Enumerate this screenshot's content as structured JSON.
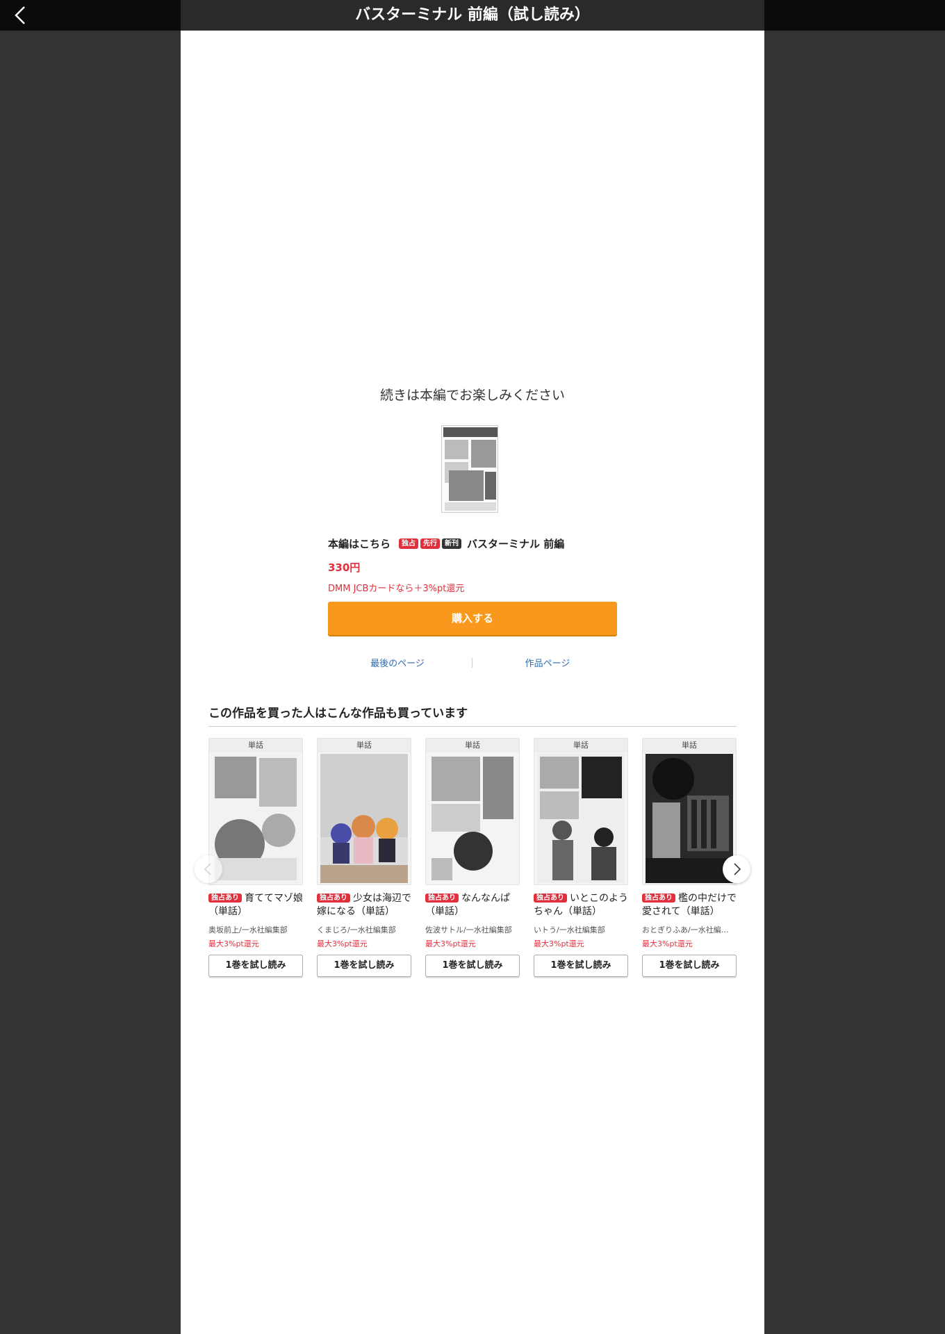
{
  "header": {
    "title": "バスターミナル 前編（試し読み）",
    "back_icon": "chevron-left-icon"
  },
  "end_of_sample": {
    "message": "続きは本編でお楽しみください",
    "product_lead": "本編はこちら",
    "badges": [
      "独占",
      "先行",
      "新刊"
    ],
    "product_title": "バスターミナル 前編",
    "price": "330円",
    "campaign": "DMM JCBカードなら＋3%pt還元",
    "buy_label": "購入する",
    "last_page_label": "最後のページ",
    "work_page_label": "作品ページ"
  },
  "recommendations": {
    "heading": "この作品を買った人はこんな作品も買っています",
    "items": [
      {
        "type": "単話",
        "badge": "独占あり",
        "title": "育ててマゾ娘（単話）",
        "author": "奥坂前上/一水社編集部",
        "point": "最大3%pt還元",
        "button": "1巻を試し読み"
      },
      {
        "type": "単話",
        "badge": "独占あり",
        "title": "少女は海辺で嫁になる（単話）",
        "author": "くまじろ/一水社編集部",
        "point": "最大3%pt還元",
        "button": "1巻を試し読み"
      },
      {
        "type": "単話",
        "badge": "独占あり",
        "title": "なんなんぱ（単話）",
        "author": "佐波サトル/一水社編集部",
        "point": "最大3%pt還元",
        "button": "1巻を試し読み"
      },
      {
        "type": "単話",
        "badge": "独占あり",
        "title": "いとこのようちゃん（単話）",
        "author": "いトう/一水社編集部",
        "point": "最大3%pt還元",
        "button": "1巻を試し読み"
      },
      {
        "type": "単話",
        "badge": "独占あり",
        "title": "檻の中だけで愛されて（単話）",
        "author": "おとぎりふあ/一水社編…",
        "point": "最大3%pt還元",
        "button": "1巻を試し読み"
      }
    ],
    "prev_icon": "chevron-left-icon",
    "next_icon": "chevron-right-icon"
  },
  "colors": {
    "accent_orange": "#f8981d",
    "price_red": "#e0303d",
    "link_blue": "#2f6bb0"
  }
}
